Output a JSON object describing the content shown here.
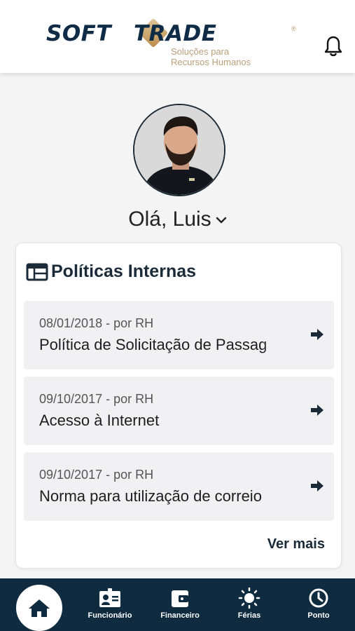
{
  "header": {
    "logo_left": "SOFT",
    "logo_right": "TRADE",
    "logo_registered": "®",
    "logo_tagline": "Soluções para\nRecursos Humanos",
    "bell_icon": "bell-icon"
  },
  "profile": {
    "greeting": "Olá, Luis",
    "avatar_icon": "user-avatar"
  },
  "policies": {
    "title": "Políticas Internas",
    "title_icon": "calendar-grid-icon",
    "items": [
      {
        "meta": "08/01/2018 - por RH",
        "title": "Política de Solicitação de Passag"
      },
      {
        "meta": "09/10/2017 - por RH",
        "title": "Acesso à Internet"
      },
      {
        "meta": "09/10/2017 - por RH",
        "title": "Norma para utilização de correio"
      }
    ],
    "more_label": "Ver mais"
  },
  "nav": {
    "items": [
      {
        "label": "Funcionário",
        "icon": "id-card-icon"
      },
      {
        "label": "Financeiro",
        "icon": "wallet-icon"
      },
      {
        "label": "Férias",
        "icon": "sun-icon"
      },
      {
        "label": "Ponto",
        "icon": "clock-icon"
      }
    ],
    "home_icon": "home-icon"
  },
  "colors": {
    "primary": "#0f2b40",
    "card_bg": "#ffffff",
    "item_bg": "#f1f1f3",
    "logo_gold": "#b98d4c"
  }
}
